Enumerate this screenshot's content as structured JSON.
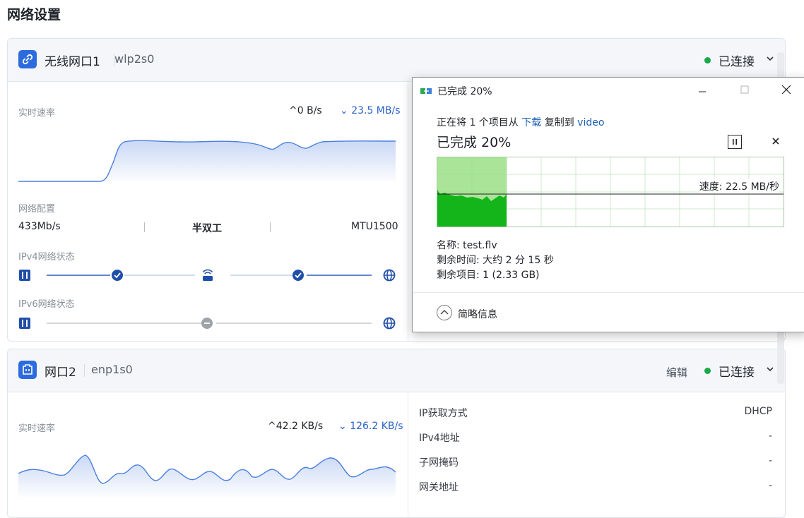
{
  "page_title": "网络设置",
  "colors": {
    "accent": "#2c6bde",
    "connected": "#19a84a",
    "download": "#2a62c9",
    "graph_green": "#13b51a"
  },
  "iface1": {
    "name": "无线网口1",
    "device": "wlp2s0",
    "icon": "link-icon",
    "status": "已连接",
    "realtime_label": "实时速率",
    "upload": "^0 B/s",
    "download": "23.5 MB/s",
    "config_label": "网络配置",
    "speed": "433Mb/s",
    "duplex": "半双工",
    "mtu": "MTU1500",
    "ipv4_label": "IPv4网络状态",
    "ipv6_label": "IPv6网络状态"
  },
  "iface2": {
    "name": "网口2",
    "device": "enp1s0",
    "icon": "ethernet-port-icon",
    "edit": "编辑",
    "status": "已连接",
    "realtime_label": "实时速率",
    "upload": "42.2 KB/s",
    "download": "126.2 KB/s",
    "info": [
      {
        "label": "IP获取方式",
        "value": "DHCP"
      },
      {
        "label": "IPv4地址",
        "value": "-"
      },
      {
        "label": "子网掩码",
        "value": "-"
      },
      {
        "label": "网关地址",
        "value": "-"
      }
    ]
  },
  "dialog": {
    "title": "已完成 20%",
    "line_prefix": "正在将 1 个项目从 ",
    "from": "下载",
    "line_mid": " 复制到 ",
    "to": "video",
    "progress_text": "已完成 20%",
    "progress": 0.2,
    "speed": "速度: 22.5 MB/秒",
    "name": "名称: test.flv",
    "remaining_time": "剩余时间: 大约 2 分 15 秒",
    "remaining_items": "剩余项目: 1 (2.33 GB)",
    "collapse": "简略信息"
  }
}
